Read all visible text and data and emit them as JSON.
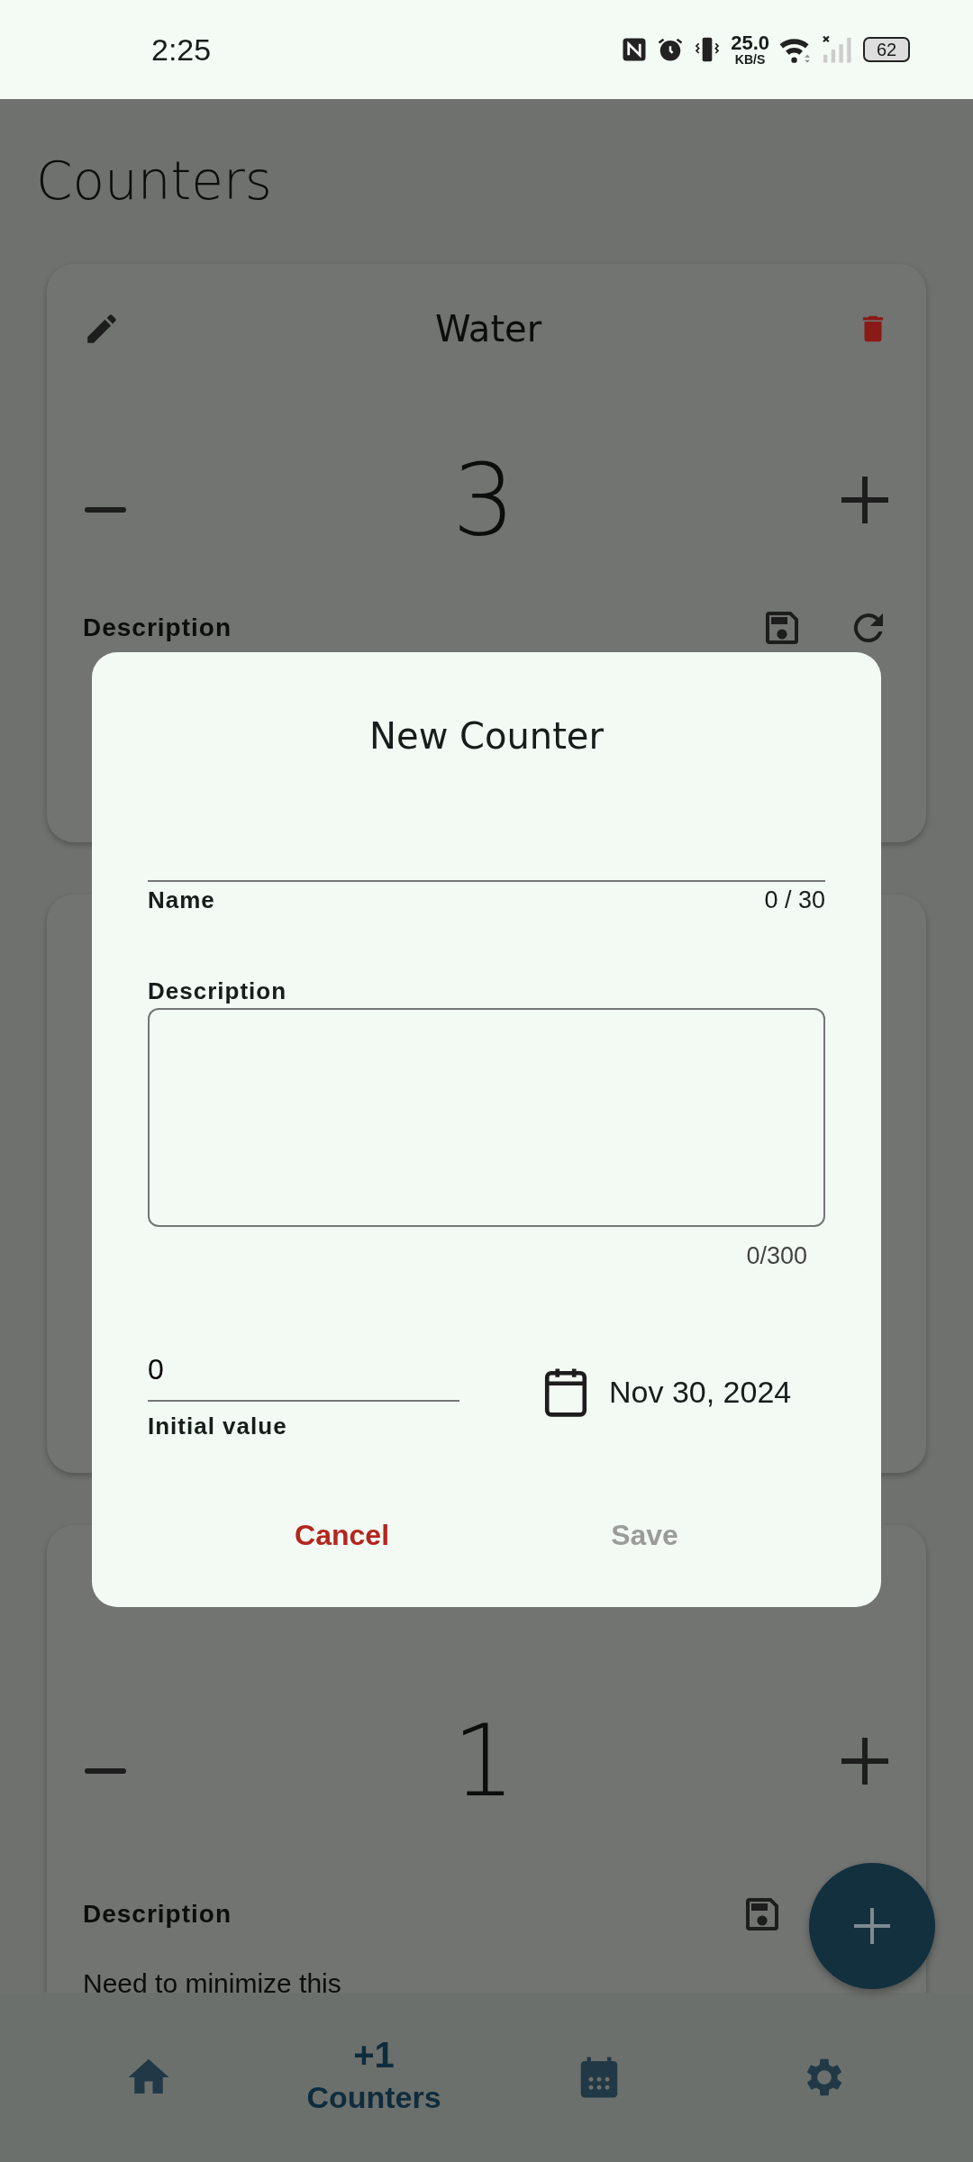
{
  "status_bar": {
    "time": "2:25",
    "speed_value": "25.0",
    "speed_unit": "KB/S",
    "battery": "62"
  },
  "page_title": "Counters",
  "cards": [
    {
      "kind": "full",
      "title": "Water",
      "value": "3",
      "description_label": "Description"
    },
    {
      "kind": "covered"
    },
    {
      "kind": "full",
      "value": "1",
      "description_label": "Description",
      "description": "Need to minimize this"
    }
  ],
  "nav": [
    {
      "kind": "home",
      "selected": false
    },
    {
      "kind": "counters",
      "icon_text": "+1",
      "label": "Counters",
      "selected": true
    },
    {
      "kind": "calendar",
      "selected": false
    },
    {
      "kind": "settings",
      "selected": false
    }
  ],
  "dialog": {
    "title": "New Counter",
    "name_label": "Name",
    "name_counter": "0 / 30",
    "description_label": "Description",
    "description_counter": "0/300",
    "initial_value": "0",
    "initial_label": "Initial value",
    "date": "Nov 30, 2024",
    "buttons": [
      {
        "kind": "cancel",
        "label": "Cancel",
        "disabled": false
      },
      {
        "kind": "save",
        "label": "Save",
        "disabled": true
      }
    ]
  }
}
